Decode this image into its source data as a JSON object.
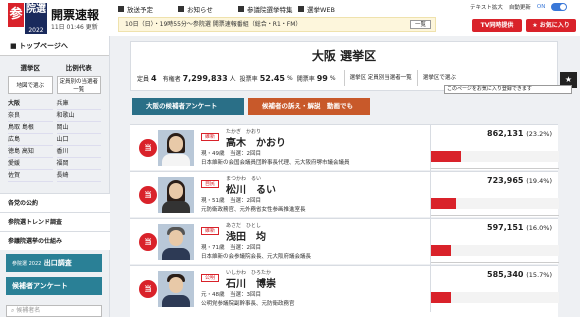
{
  "header": {
    "logo": {
      "kanji1": "参",
      "kanji2": "院選",
      "year": "2022"
    },
    "title": "開票速報",
    "date": "11日 01:46 更新",
    "nav": [
      {
        "label": "放送予定"
      },
      {
        "label": "お知らせ"
      },
      {
        "label": "参議院選挙特集"
      },
      {
        "label": "選挙WEB"
      }
    ],
    "ticker": "10日（日）・19時55分～参院選 開票速報番組（総合・R1・FM）",
    "ticker_more": "一覧",
    "links": {
      "text_size": "テキスト拡大",
      "auto_update": "自動更新",
      "toggle": "ON"
    },
    "tv_button": "TV同時提供",
    "fav_button": "お気に入り"
  },
  "sidebar": {
    "top": "トップページへ",
    "tabs": [
      "選挙区",
      "比例代表"
    ],
    "dropdowns": [
      "地図で選ぶ",
      "定員別の当選者一覧"
    ],
    "prefectures": [
      {
        "l": "大阪",
        "r": "兵庫",
        "on": true
      },
      {
        "l": "奈良",
        "r": "和歌山"
      },
      {
        "l": "鳥取 島根",
        "r": "岡山"
      },
      {
        "l": "広島",
        "r": "山口"
      },
      {
        "l": "徳島 高知",
        "r": "香川"
      },
      {
        "l": "愛媛",
        "r": "福岡"
      },
      {
        "l": "佐賀",
        "r": "長崎"
      }
    ],
    "links": [
      "各党の公約",
      "参院選トレンド調査",
      "参議院選挙の仕組み"
    ],
    "exit_poll": "出口調査",
    "exit_poll_tag": "参院選 2022",
    "survey": "候補者アンケート",
    "search_placeholder": "候補者名"
  },
  "main": {
    "title": "大阪 選挙区",
    "stats": {
      "seats_label": "定員",
      "seats": "4",
      "voters_label": "有権者",
      "voters": "7,299,833",
      "voters_unit": "人",
      "turnout_label": "投票率",
      "turnout": "52.45",
      "turnout_unit": "%",
      "counted_label": "開票率",
      "counted": "99",
      "counted_unit": "%"
    },
    "selects": [
      "選挙区 定員別当選者一覧",
      "選挙区で選ぶ"
    ],
    "tooltip": "このページをお気に入り登録できます",
    "tab_survey": "大阪の候補者アンケート",
    "tab_video": "候補者の訴え・解説　動画でも"
  },
  "candidates": [
    {
      "badge": "当",
      "party": "維新",
      "kana": "たかぎ　かおり",
      "name": "高木　かおり",
      "info": "現・49歳　当選：2回目",
      "bio": "日本維新の会国会議員団幹事長代理、元大阪府堺市議会議員",
      "votes": "862,131",
      "pct": "(23.2%)",
      "share": 23.2
    },
    {
      "badge": "当",
      "party": "自民",
      "kana": "まつかわ　るい",
      "name": "松川　るい",
      "info": "現・51歳　当選：2回目",
      "bio": "元防衛政務官、元外務省女性参画推進室長",
      "votes": "723,965",
      "pct": "(19.4%)",
      "share": 19.4
    },
    {
      "badge": "当",
      "party": "維新",
      "kana": "あさだ　ひとし",
      "name": "浅田　均",
      "info": "現・71歳　当選：2回目",
      "bio": "日本維新の会参議院会長、元大阪府議会議長",
      "votes": "597,151",
      "pct": "(16.0%)",
      "share": 16.0
    },
    {
      "badge": "当",
      "party": "公明",
      "kana": "いしかわ　ひろたか",
      "name": "石川　博崇",
      "info": "元・48歳　当選：3回目",
      "bio": "公明党参議院副幹事長、元防衛政務官",
      "votes": "585,340",
      "pct": "(15.7%)",
      "share": 15.7
    }
  ]
}
